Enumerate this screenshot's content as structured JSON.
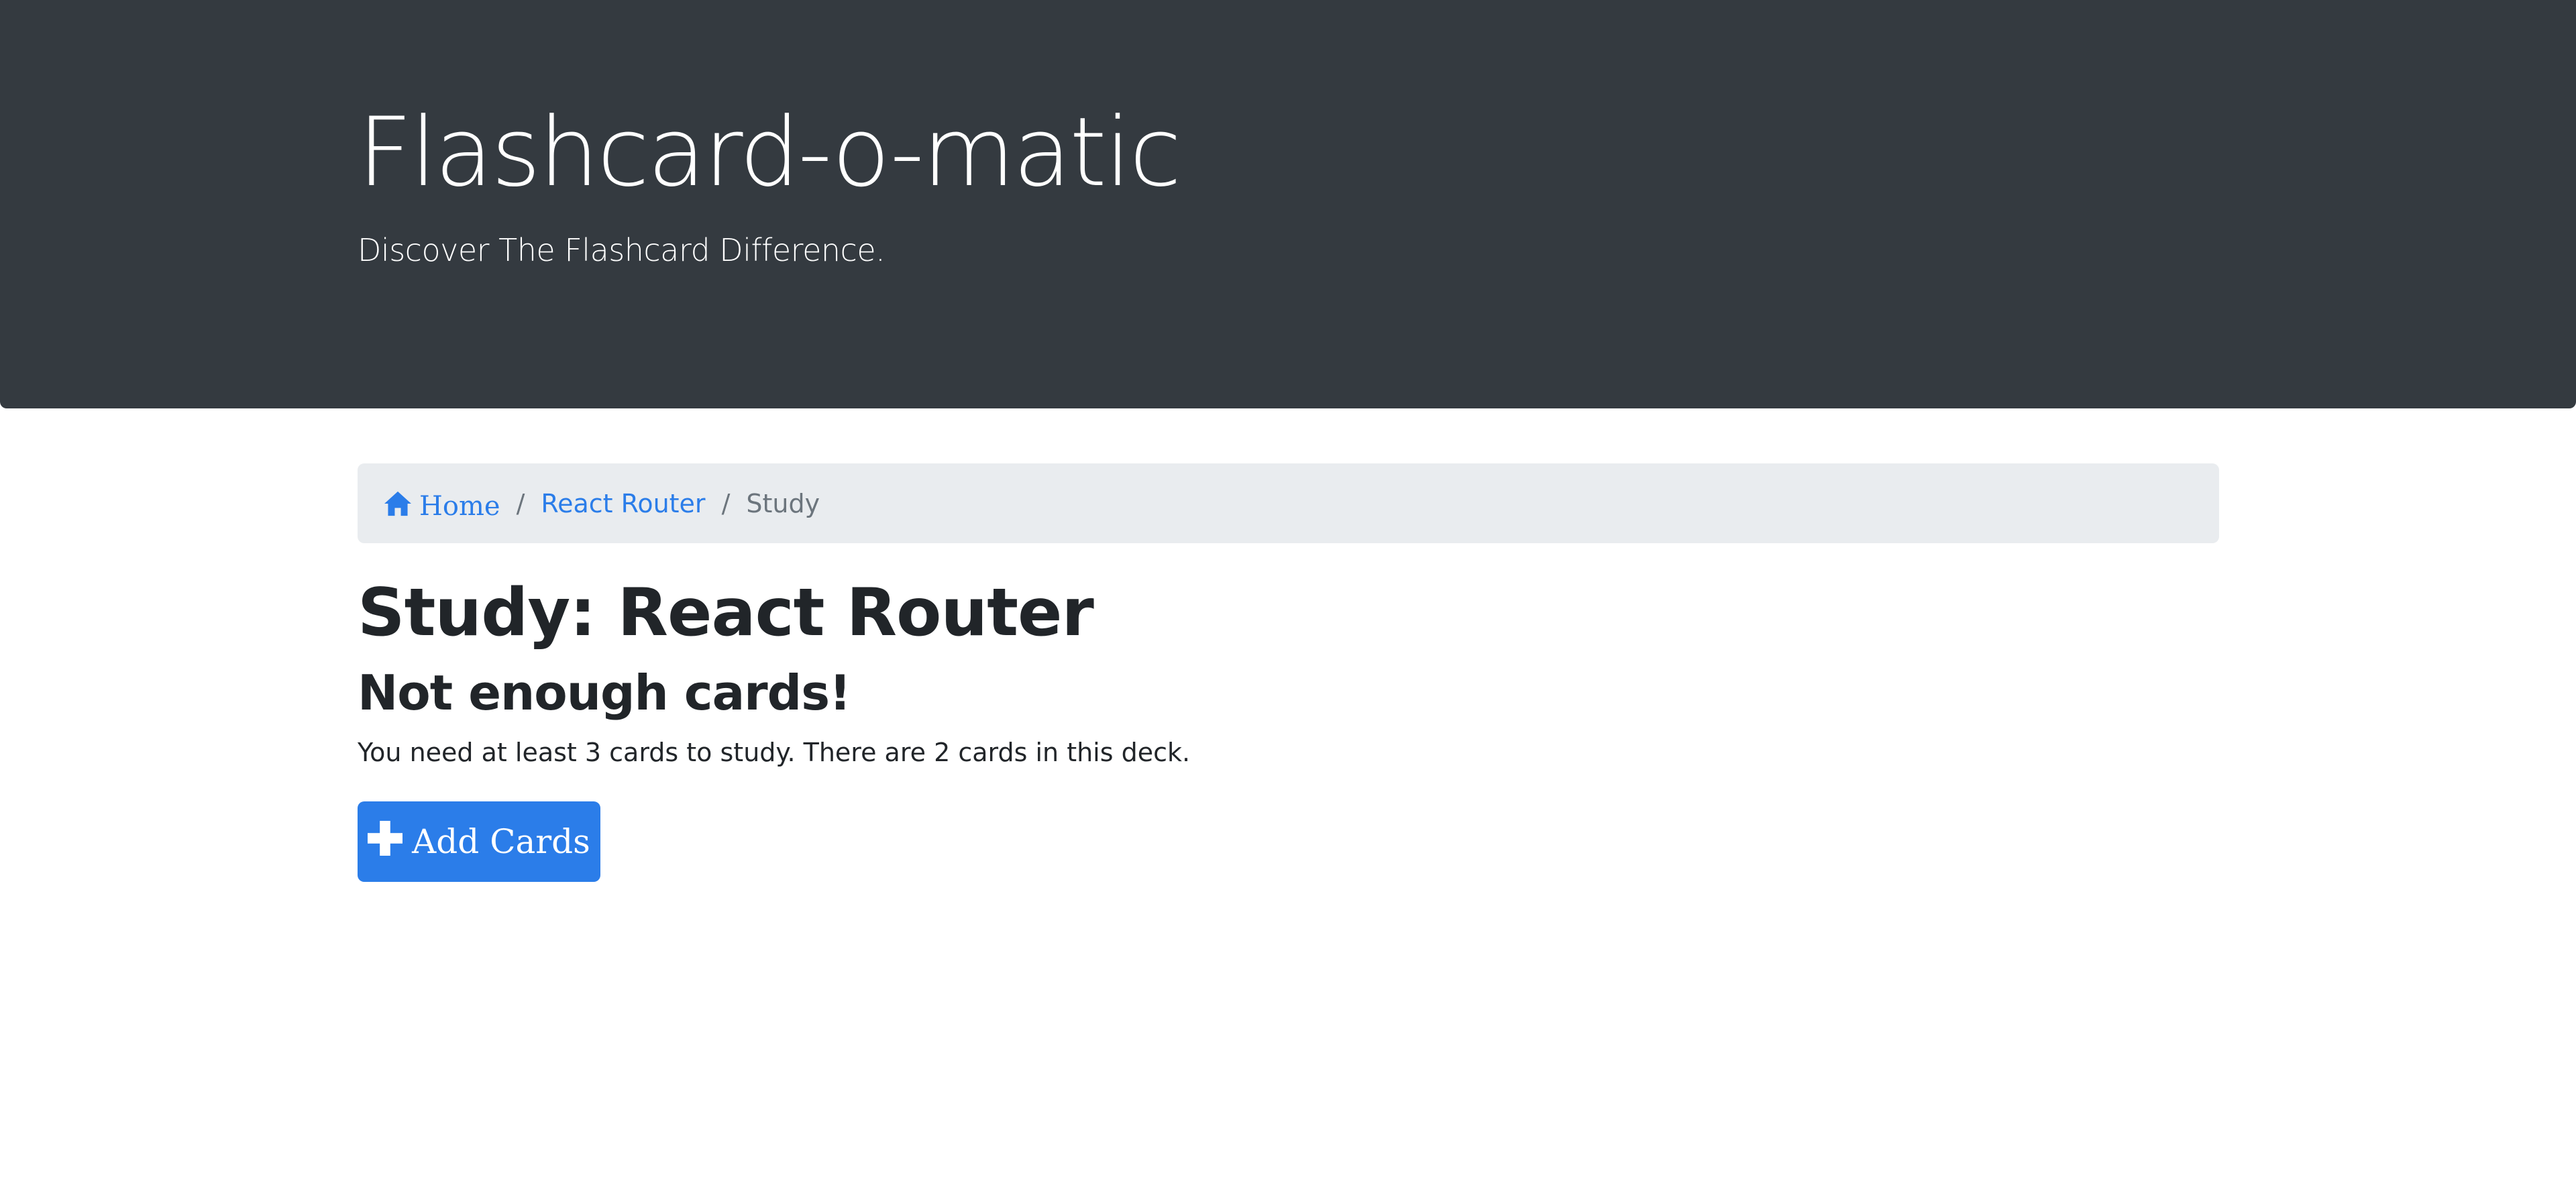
{
  "header": {
    "title": "Flashcard-o-matic",
    "lead": "Discover The Flashcard Difference."
  },
  "breadcrumb": {
    "home_label": "Home",
    "home_icon": "house-icon",
    "deck_label": "React Router",
    "current_label": "Study",
    "separator": "/"
  },
  "main": {
    "title": "Study: React Router",
    "subtitle": "Not enough cards!",
    "message": "You need at least 3 cards to study. There are 2 cards in this deck.",
    "add_button_label": "Add Cards",
    "add_button_icon": "plus-icon"
  },
  "colors": {
    "header_bg": "#343a40",
    "breadcrumb_bg": "#e9ecef",
    "link": "#2b7de9",
    "primary_button": "#2b7de9",
    "text": "#212529",
    "muted": "#6c757d"
  }
}
